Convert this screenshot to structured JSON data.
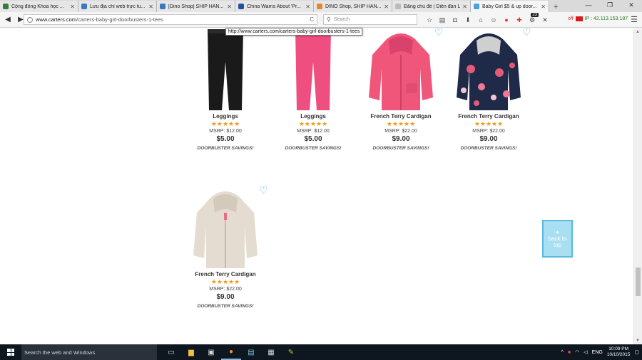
{
  "browser": {
    "tabs": [
      {
        "label": "Cộng đồng Khoa học ...",
        "fav_color": "#3b7a3b",
        "active": false
      },
      {
        "label": "Lưu địa chỉ web trực tu...",
        "fav_color": "#3c78c2",
        "active": false
      },
      {
        "label": "[Dino Shop] SHIP HÀN...",
        "fav_color": "#3c78c2",
        "active": false
      },
      {
        "label": "China Warns About 'Pr...",
        "fav_color": "#2450a0",
        "active": false
      },
      {
        "label": "DINO Shop, SHIP HÀN...",
        "fav_color": "#e08a2a",
        "active": false
      },
      {
        "label": "Đăng chủ đề | Diễn đàn LÀ...",
        "fav_color": "#bbbbbb",
        "active": false
      },
      {
        "label": "Baby Girl $5 & up door...",
        "fav_color": "#4aa3d8",
        "active": true
      }
    ],
    "new_tab_symbol": "+",
    "url_host": "www.carters.com",
    "url_path": "/carters-baby-girl-doorbusters-1-tees",
    "reload_symbol": "C",
    "search_placeholder": "Search",
    "ip_status": "off",
    "ip_label": "IP : 42.113.153.187",
    "notification_count": "23",
    "link_tooltip": "http://www.carters.com/carters-baby-girl-doorbusters-1-tees"
  },
  "products": [
    {
      "name": "Leggings",
      "stars": "★★★★★",
      "msrp": "MSRP: $12.00",
      "price": "$5.00",
      "promo": "DOORBUSTER SAVINGS!",
      "color": "#1a1a1a",
      "type": "leggings"
    },
    {
      "name": "Leggings",
      "stars": "★★★★★",
      "msrp": "MSRP: $12.00",
      "price": "$5.00",
      "promo": "DOORBUSTER SAVINGS!",
      "color": "#ee4f80",
      "type": "leggings"
    },
    {
      "name": "French Terry Cardigan",
      "stars": "★★★★★",
      "msrp": "MSRP: $22.00",
      "price": "$9.00",
      "promo": "DOORBUSTER SAVINGS!",
      "color": "#f0567a",
      "type": "cardigan"
    },
    {
      "name": "French Terry Cardigan",
      "stars": "★★★★★",
      "msrp": "MSRP: $22.00",
      "price": "$9.00",
      "promo": "DOORBUSTER SAVINGS!",
      "color": "#1f2a48",
      "type": "floral"
    },
    {
      "name": "French Terry Cardigan",
      "stars": "★★★★★",
      "msrp": "MSRP: $22.00",
      "price": "$9.00",
      "promo": "DOORBUSTER SAVINGS!",
      "color": "#e4dcd0",
      "type": "cardigan"
    }
  ],
  "back_to_top": {
    "arrow": "▲",
    "label": "back to top"
  },
  "taskbar": {
    "search_placeholder": "Search the web and Windows",
    "language": "ENG",
    "time": "10:09 PM",
    "date": "10/10/2015"
  }
}
